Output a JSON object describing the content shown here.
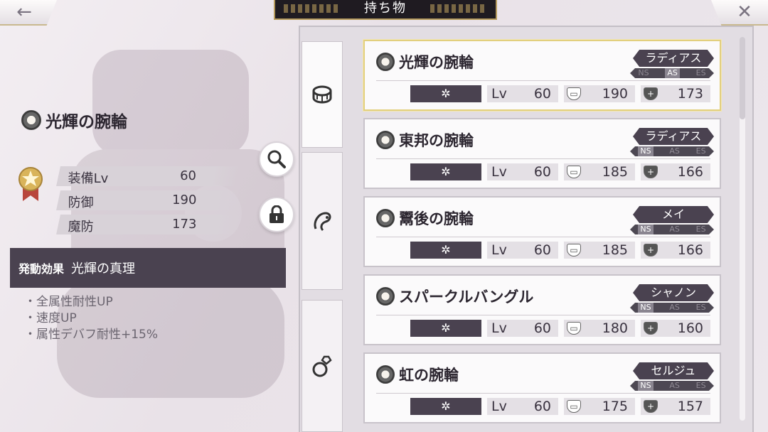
{
  "header": {
    "title": "持ち物",
    "back_icon": "←",
    "close_icon": "✕"
  },
  "detail": {
    "item_name": "光輝の腕輪",
    "stats": [
      {
        "label": "装備Lv",
        "value": "60"
      },
      {
        "label": "防御",
        "value": "190"
      },
      {
        "label": "魔防",
        "value": "173"
      }
    ],
    "effect_tag": "発動効果",
    "effect_name": "光輝の真理",
    "effect_lines": [
      "全属性耐性UP",
      "速度UP",
      "属性デバフ耐性+15%"
    ]
  },
  "buttons": {
    "search_icon": "search-icon",
    "lock_icon": "lock-icon"
  },
  "items": [
    {
      "name": "光輝の腕輪",
      "character": "ラディアス",
      "slots": [
        "NS",
        "AS",
        "ES"
      ],
      "active_slot": "AS",
      "element": "✲",
      "lv_label": "Lv",
      "lv": "60",
      "def": "190",
      "mdef": "173",
      "selected": true
    },
    {
      "name": "東邦の腕輪",
      "character": "ラディアス",
      "slots": [
        "NS",
        "AS",
        "ES"
      ],
      "active_slot": "NS",
      "element": "✲",
      "lv_label": "Lv",
      "lv": "60",
      "def": "185",
      "mdef": "166",
      "selected": false
    },
    {
      "name": "鬻後の腕輪",
      "character": "メイ",
      "slots": [
        "NS",
        "AS",
        "ES"
      ],
      "active_slot": "NS",
      "element": "✲",
      "lv_label": "Lv",
      "lv": "60",
      "def": "185",
      "mdef": "166",
      "selected": false
    },
    {
      "name": "スパークルバングル",
      "character": "シャノン",
      "slots": [
        "NS",
        "AS",
        "ES"
      ],
      "active_slot": "NS",
      "element": "✲",
      "lv_label": "Lv",
      "lv": "60",
      "def": "180",
      "mdef": "160",
      "selected": false
    },
    {
      "name": "虹の腕輪",
      "character": "セルジュ",
      "slots": [
        "NS",
        "AS",
        "ES"
      ],
      "active_slot": "NS",
      "element": "✲",
      "lv_label": "Lv",
      "lv": "60",
      "def": "175",
      "mdef": "157",
      "selected": false
    }
  ],
  "colors": {
    "accent_dark": "#4a4250",
    "selected_border": "#e2cf7e",
    "gold_trim": "#b59a5c"
  }
}
